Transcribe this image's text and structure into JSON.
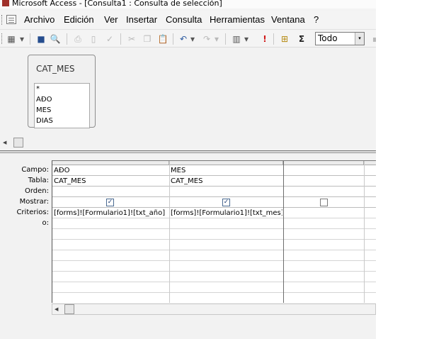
{
  "window": {
    "title": "Microsoft Access - [Consulta1 : Consulta de selección]"
  },
  "menubar": {
    "items": [
      "Archivo",
      "Edición",
      "Ver",
      "Insertar",
      "Consulta",
      "Herramientas",
      "Ventana",
      "?"
    ]
  },
  "toolbar": {
    "icons": [
      "view-icon",
      "dropdown-arrow-icon",
      "save-icon",
      "search-file-icon",
      "print-icon",
      "print-preview-icon",
      "spelling-icon",
      "cut-icon",
      "copy-icon",
      "paste-icon",
      "undo-icon",
      "redo-icon",
      "query-type-icon",
      "run-icon",
      "show-table-icon",
      "totals-icon"
    ],
    "glyphs": {
      "view": "▦",
      "dropdown": "▾",
      "save": "■",
      "search": "🔍",
      "print": "⎙",
      "preview": "▯",
      "spelling": "✓",
      "cut": "✂",
      "copy": "❐",
      "paste": "📋",
      "undo": "↶",
      "redo": "↷",
      "querytype": "▥",
      "run": "!",
      "showtable": "⊞",
      "totals": "Σ"
    },
    "top_values_combo": {
      "value": "Todo"
    }
  },
  "table_box": {
    "name": "CAT_MES",
    "fields": [
      "*",
      "AÐO",
      "MES",
      "DIAS"
    ]
  },
  "design_grid": {
    "row_labels": [
      "Campo:",
      "Tabla:",
      "Orden:",
      "Mostrar:",
      "Criterios:",
      "o:"
    ],
    "columns": [
      {
        "field": "AÐO",
        "table": "CAT_MES",
        "sort": "",
        "show": true,
        "criteria": "[forms]![Formulario1]![txt_año]",
        "or": ""
      },
      {
        "field": "MES",
        "table": "CAT_MES",
        "sort": "",
        "show": true,
        "criteria": "[forms]![Formulario1]![txt_mes]",
        "or": ""
      },
      {
        "field": "",
        "table": "",
        "sort": "",
        "show": false,
        "criteria": "",
        "or": ""
      }
    ]
  },
  "glyphs": {
    "checked": "✓",
    "scroll_left": "◀"
  }
}
